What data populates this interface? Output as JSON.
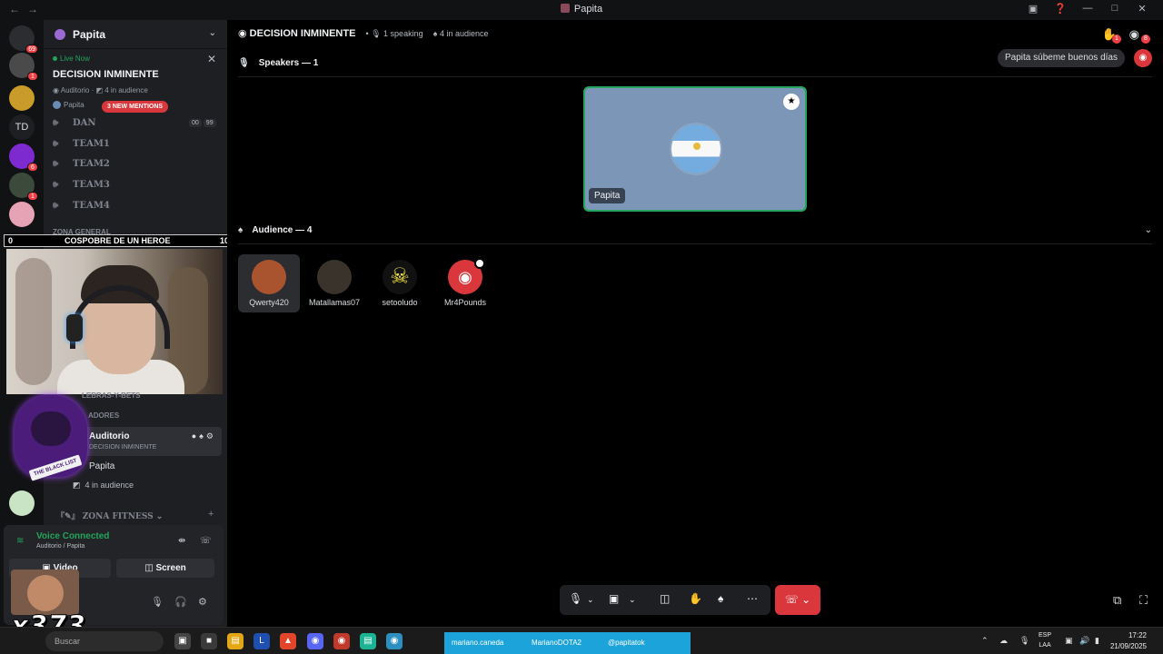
{
  "window": {
    "title": "Papita"
  },
  "server": {
    "name": "Papita"
  },
  "live_card": {
    "status": "Live Now",
    "title": "DECISION INMINENTE",
    "channel": "Auditorio",
    "audience": "4 in audience",
    "host": "Papita"
  },
  "channels": [
    {
      "name": "DAN"
    },
    {
      "name": "TEAM1"
    },
    {
      "name": "TEAM2"
    },
    {
      "name": "TEAM3"
    },
    {
      "name": "TEAM4"
    }
  ],
  "mentions_pill": "3 NEW MENTIONS",
  "dan_counters": [
    "00",
    "99"
  ],
  "categories": {
    "general": "ZONA GENERAL",
    "bets": "LEBRAS-Y-BETS",
    "jugadores": "ADORES",
    "fitness": "ZONA FITNESS"
  },
  "overlay": {
    "left": "0",
    "title": "COSPOBRE DE UN HEROE",
    "right": "10"
  },
  "blacklist_text": "THE BLACK LIST",
  "voice_channel": {
    "name": "Auditorio",
    "subtitle": "DECISION INMINENTE",
    "user": "Papita",
    "audience": "4 in audience"
  },
  "voice_panel": {
    "status": "Voice Connected",
    "location": "Auditorio / Papita",
    "video_label": "Video",
    "screen_label": "Screen"
  },
  "reaction_text": "x373",
  "stage": {
    "title": "DECISION INMINENTE",
    "speaking": "1 speaking",
    "audience": "4 in audience",
    "speakers_header": "Speakers — 1",
    "audience_header": "Audience — 4",
    "speaker_name": "Papita",
    "audience_members": [
      {
        "name": "Qwerty420",
        "color": "#a9542f"
      },
      {
        "name": "Matallamas07",
        "color": "#3a332c"
      },
      {
        "name": "setooludo",
        "color": "#111111"
      },
      {
        "name": "Mr4Pounds",
        "color": "#da373c"
      }
    ]
  },
  "header": {
    "raise_hand_count": "1",
    "inbox_count": "8"
  },
  "toast": "Papita súbeme buenos días",
  "guild_badges": [
    "69",
    "1",
    "6",
    "1"
  ],
  "taskbar": {
    "search": "Buscar",
    "social": [
      "mariano.caneda",
      "MarianoDOTA2",
      "@papitatok"
    ],
    "lang_1": "ESP",
    "lang_2": "LAA",
    "time": "17:22",
    "date": "21/09/2025"
  },
  "colors": {
    "accent_green": "#23a55a",
    "danger": "#da373c",
    "tile": "#7b96b6"
  }
}
